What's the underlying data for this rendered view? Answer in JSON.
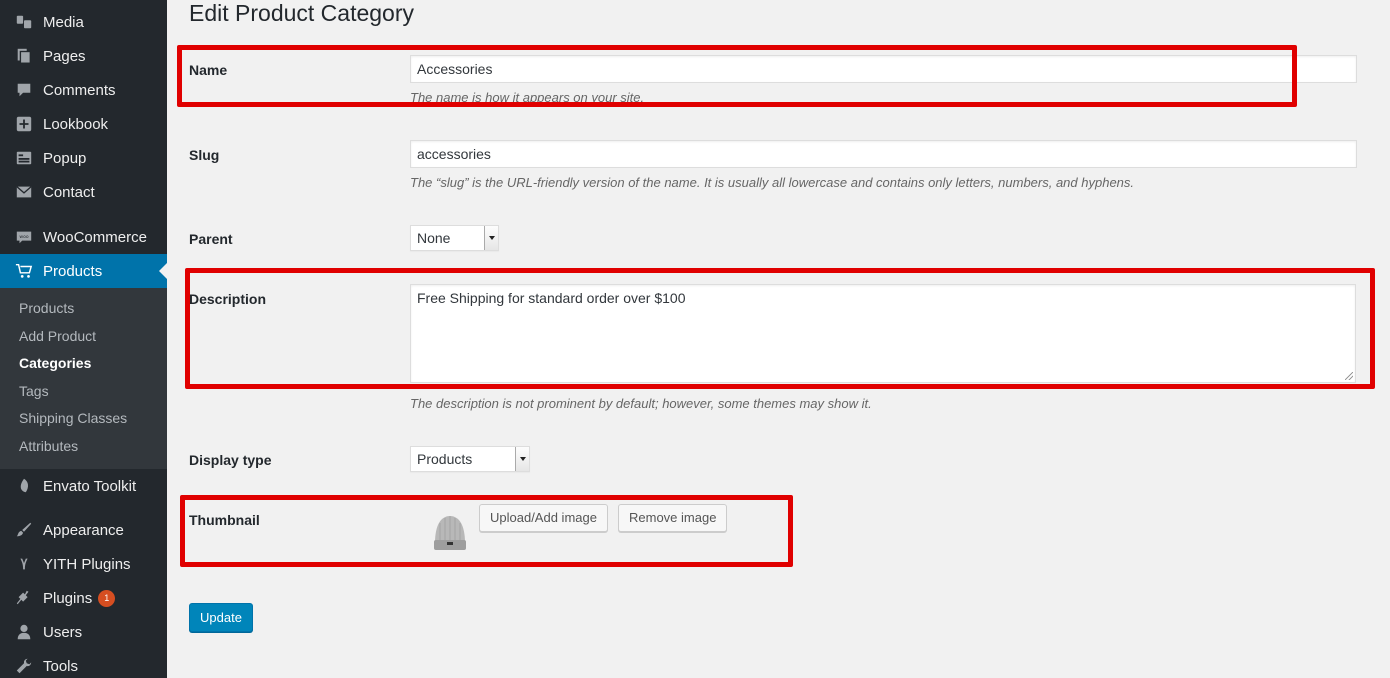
{
  "sidebar": {
    "items": [
      {
        "label": "Media",
        "icon": "media-icon"
      },
      {
        "label": "Pages",
        "icon": "pages-icon"
      },
      {
        "label": "Comments",
        "icon": "comments-icon"
      },
      {
        "label": "Lookbook",
        "icon": "plus-icon"
      },
      {
        "label": "Popup",
        "icon": "popup-icon"
      },
      {
        "label": "Contact",
        "icon": "mail-icon"
      },
      {
        "label": "WooCommerce",
        "icon": "woocommerce-icon"
      },
      {
        "label": "Products",
        "icon": "cart-icon",
        "active": true
      },
      {
        "label": "Envato Toolkit",
        "icon": "leaf-icon"
      },
      {
        "label": "Appearance",
        "icon": "paintbrush-icon"
      },
      {
        "label": "YITH Plugins",
        "icon": "yith-icon"
      },
      {
        "label": "Plugins",
        "icon": "plug-icon",
        "badge": "1"
      },
      {
        "label": "Users",
        "icon": "users-icon"
      },
      {
        "label": "Tools",
        "icon": "wrench-icon"
      }
    ],
    "submenu": [
      {
        "label": "Products"
      },
      {
        "label": "Add Product"
      },
      {
        "label": "Categories",
        "current": true
      },
      {
        "label": "Tags"
      },
      {
        "label": "Shipping Classes"
      },
      {
        "label": "Attributes"
      }
    ]
  },
  "main": {
    "title": "Edit Product Category",
    "name": {
      "label": "Name",
      "value": "Accessories",
      "hint": "The name is how it appears on your site."
    },
    "slug": {
      "label": "Slug",
      "value": "accessories",
      "hint": "The “slug” is the URL-friendly version of the name. It is usually all lowercase and contains only letters, numbers, and hyphens."
    },
    "parent": {
      "label": "Parent",
      "value": "None"
    },
    "description": {
      "label": "Description",
      "value": "Free Shipping for standard order over $100",
      "hint": "The description is not prominent by default; however, some themes may show it."
    },
    "display_type": {
      "label": "Display type",
      "value": "Products"
    },
    "thumbnail": {
      "label": "Thumbnail",
      "upload_label": "Upload/Add image",
      "remove_label": "Remove image",
      "image": "beanie-hat-thumbnail"
    },
    "update_label": "Update"
  },
  "colors": {
    "sidebar_bg": "#23282d",
    "submenu_bg": "#32373c",
    "accent": "#0073aa",
    "highlight": "#e00000",
    "page_bg": "#f1f1f1",
    "badge": "#d54e21"
  }
}
